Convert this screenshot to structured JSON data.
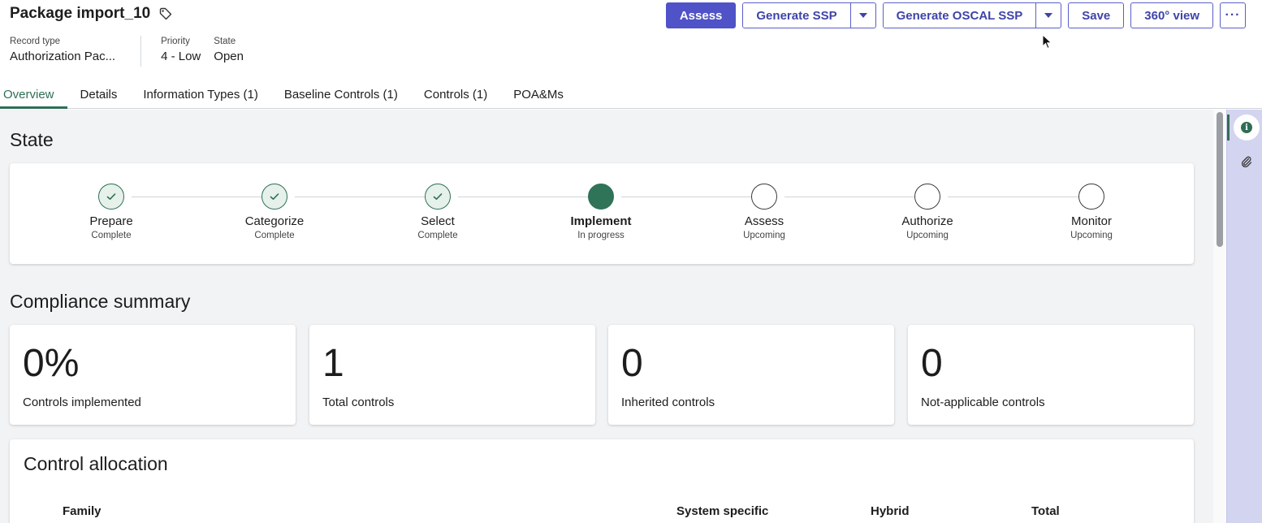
{
  "header": {
    "title": "Package import_10",
    "meta": {
      "record_type_label": "Record type",
      "record_type_value": "Authorization Pac...",
      "priority_label": "Priority",
      "priority_value": "4 - Low",
      "state_label": "State",
      "state_value": "Open"
    },
    "actions": {
      "assess": "Assess",
      "generate_ssp": "Generate SSP",
      "generate_oscal_ssp": "Generate OSCAL SSP",
      "save": "Save",
      "view_360": "360° view",
      "more": "···"
    },
    "tabs": [
      {
        "label": "Overview",
        "active": true
      },
      {
        "label": "Details"
      },
      {
        "label": "Information Types (1)"
      },
      {
        "label": "Baseline Controls (1)"
      },
      {
        "label": "Controls (1)"
      },
      {
        "label": "POA&Ms"
      }
    ]
  },
  "state_section": {
    "title": "State",
    "steps": [
      {
        "name": "Prepare",
        "status": "Complete",
        "kind": "done"
      },
      {
        "name": "Categorize",
        "status": "Complete",
        "kind": "done"
      },
      {
        "name": "Select",
        "status": "Complete",
        "kind": "done"
      },
      {
        "name": "Implement",
        "status": "In progress",
        "kind": "current"
      },
      {
        "name": "Assess",
        "status": "Upcoming",
        "kind": "upcoming"
      },
      {
        "name": "Authorize",
        "status": "Upcoming",
        "kind": "upcoming"
      },
      {
        "name": "Monitor",
        "status": "Upcoming",
        "kind": "upcoming"
      }
    ]
  },
  "compliance": {
    "title": "Compliance summary",
    "metrics": [
      {
        "value": "0%",
        "label": "Controls implemented"
      },
      {
        "value": "1",
        "label": "Total controls"
      },
      {
        "value": "0",
        "label": "Inherited controls"
      },
      {
        "value": "0",
        "label": "Not-applicable controls"
      }
    ]
  },
  "allocation": {
    "title": "Control allocation",
    "columns": [
      "Family",
      "System specific",
      "Hybrid",
      "Total"
    ]
  },
  "colors": {
    "accent_green": "#2f6e55",
    "button_purple": "#4f53c7",
    "rail_bg": "#d3d4ef"
  },
  "icons": {
    "tag": "tag-icon",
    "info": "info-icon",
    "attachment": "paperclip-icon",
    "check": "check-icon",
    "caret": "chevron-down-icon"
  }
}
